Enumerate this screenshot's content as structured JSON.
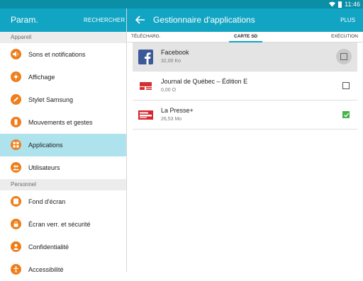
{
  "status_bar": {
    "time": "11:46"
  },
  "left_panel": {
    "title": "Param.",
    "search_label": "RECHERCHER",
    "sections": [
      {
        "header": "Appareil",
        "items": [
          {
            "label": "Sons et notifications",
            "icon": "speaker-icon"
          },
          {
            "label": "Affichage",
            "icon": "display-icon"
          },
          {
            "label": "Stylet Samsung",
            "icon": "pen-icon"
          },
          {
            "label": "Mouvements et gestes",
            "icon": "gesture-icon"
          },
          {
            "label": "Applications",
            "icon": "apps-grid-icon",
            "active": true
          },
          {
            "label": "Utilisateurs",
            "icon": "users-icon"
          }
        ]
      },
      {
        "header": "Personnel",
        "items": [
          {
            "label": "Fond d'écran",
            "icon": "wallpaper-icon"
          },
          {
            "label": "Écran verr. et sécurité",
            "icon": "lock-icon"
          },
          {
            "label": "Confidentialité",
            "icon": "privacy-icon"
          },
          {
            "label": "Accessibilité",
            "icon": "accessibility-icon"
          }
        ]
      }
    ]
  },
  "right_panel": {
    "title": "Gestionnaire d'applications",
    "more_label": "PLUS",
    "tabs": [
      {
        "label": "TÉLÉCHARG."
      },
      {
        "label": "CARTE SD",
        "active": true
      },
      {
        "label": "EXÉCUTION"
      }
    ],
    "apps": [
      {
        "name": "Facebook",
        "size": "32,00 Ko",
        "icon": "facebook-icon",
        "checked": false,
        "selected": true
      },
      {
        "name": "Journal de Québec – Édition E",
        "size": "0,00 O",
        "icon": "journal-quebec-icon",
        "checked": false
      },
      {
        "name": "La Presse+",
        "size": "26,53 Mo",
        "icon": "la-presse-icon",
        "checked": true
      }
    ]
  },
  "colors": {
    "accent": "#12a5c3",
    "status_bar": "#0a8fa6",
    "icon_orange": "#ef7d1a",
    "active_row": "#aee3ee",
    "check_green": "#43b34b"
  }
}
